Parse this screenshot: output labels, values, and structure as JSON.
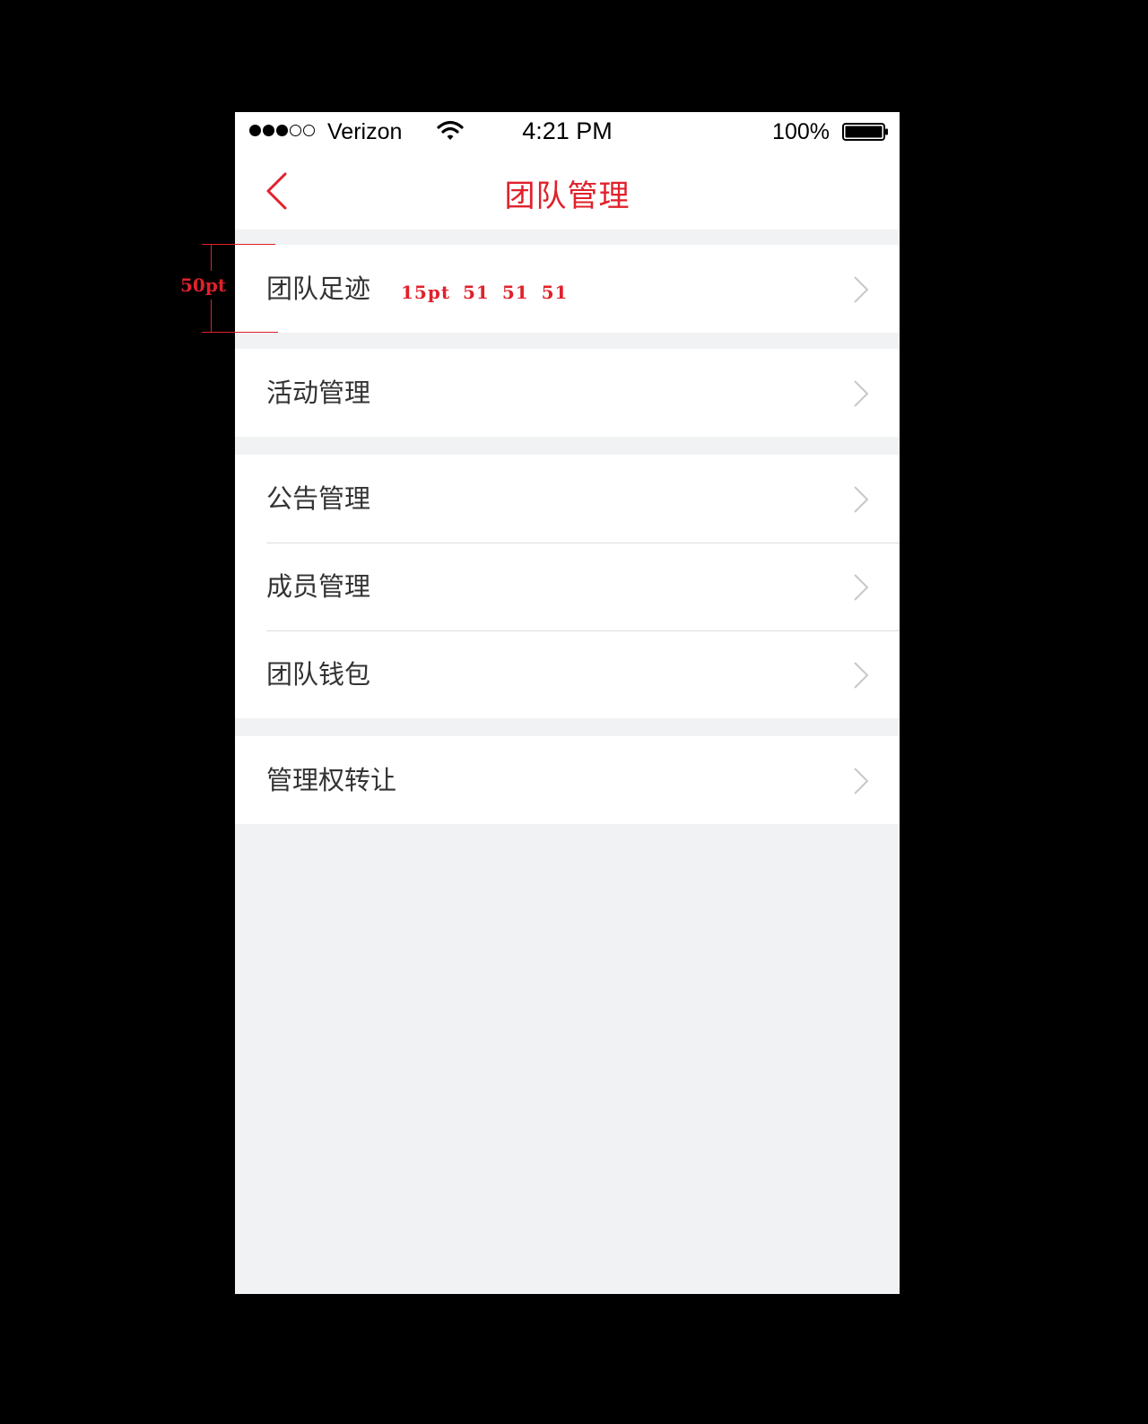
{
  "status_bar": {
    "signal_filled": 3,
    "signal_total": 5,
    "carrier": "Verizon",
    "time": "4:21 PM",
    "battery_percent": "100%",
    "battery_level": 1.0
  },
  "nav": {
    "back_icon": "chevron-left-icon",
    "title": "团队管理"
  },
  "groups": [
    {
      "items": [
        {
          "label": "团队足迹"
        }
      ]
    },
    {
      "items": [
        {
          "label": "活动管理"
        }
      ]
    },
    {
      "items": [
        {
          "label": "公告管理"
        },
        {
          "label": "成员管理"
        },
        {
          "label": "团队钱包"
        }
      ]
    },
    {
      "items": [
        {
          "label": "管理权转让"
        }
      ]
    }
  ],
  "annotations": {
    "row_height": "50pt",
    "font_spec": "15pt 51 51 51"
  },
  "colors": {
    "accent": "#e0212b",
    "background": "#f1f2f4",
    "text": "#333333",
    "chevron": "#c7c7cc"
  }
}
